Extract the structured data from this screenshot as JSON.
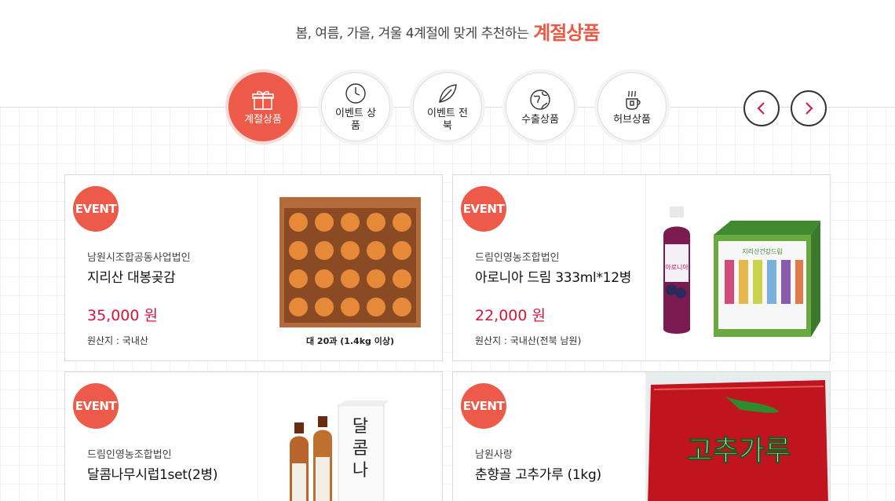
{
  "header": {
    "subtitle": "봄, 여름, 가을, 겨울 4계절에 맞게 추천하는",
    "highlight": "계절상품"
  },
  "colors": {
    "accent": "#ee5a4a",
    "price": "#d8143c"
  },
  "categories": [
    {
      "label": "계절상품",
      "icon": "gift-icon",
      "active": true
    },
    {
      "label": "이벤트 상품",
      "icon": "clock-icon",
      "active": false
    },
    {
      "label": "이벤트 전북",
      "icon": "leaf-icon",
      "active": false
    },
    {
      "label": "수출상품",
      "icon": "globe-icon",
      "active": false
    },
    {
      "label": "허브상품",
      "icon": "tea-cup-icon",
      "active": false
    }
  ],
  "nav": {
    "prev_icon": "chevron-left-icon",
    "next_icon": "chevron-right-icon"
  },
  "products": [
    {
      "badge": "EVENT",
      "seller": "남원시조합공동사업법인",
      "name": "지리산 대봉곶감",
      "price": "35,000 원",
      "origin": "원산지 : 국내산",
      "image_caption": "대 20과 (1.4kg 이상)"
    },
    {
      "badge": "EVENT",
      "seller": "드림인영농조합법인",
      "name": "아로니아 드림 333ml*12병",
      "price": "22,000 원",
      "origin": "원산지 : 국내산(전북 남원)",
      "bottle_label": "아로니아",
      "box_label": "지리산건강드림"
    },
    {
      "badge": "EVENT",
      "seller": "드림인영농조합법인",
      "name": "달콤나무시럽1set(2병)",
      "price": "",
      "origin": ""
    },
    {
      "badge": "EVENT",
      "seller": "남원사랑",
      "name": "춘향골 고추가루 (1kg)",
      "price": "",
      "origin": "",
      "bag_label": "고추가루"
    }
  ]
}
